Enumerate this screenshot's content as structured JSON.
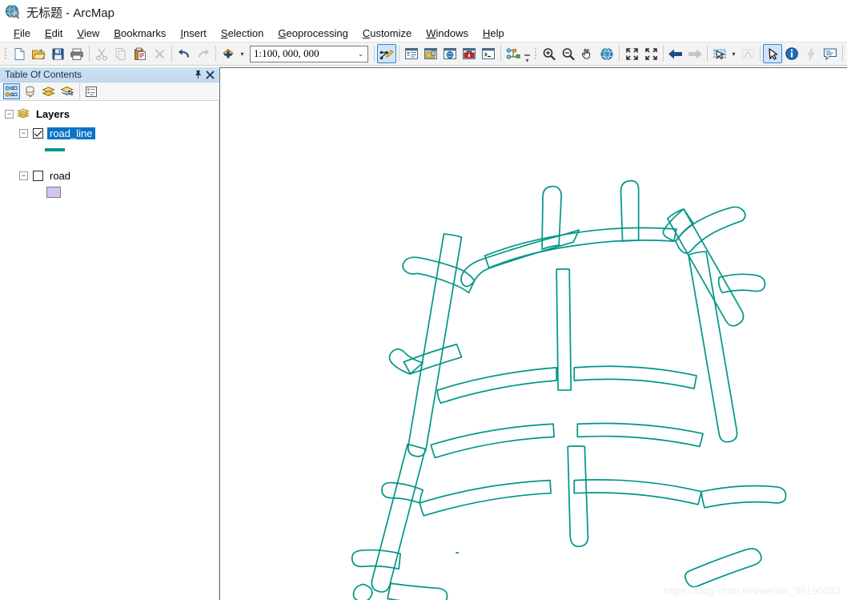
{
  "window": {
    "title": "无标题 - ArcMap",
    "app_icon": "arcmap-globe-icon"
  },
  "menubar": {
    "items": [
      {
        "label": "File",
        "accel": "F"
      },
      {
        "label": "Edit",
        "accel": "E"
      },
      {
        "label": "View",
        "accel": "V"
      },
      {
        "label": "Bookmarks",
        "accel": "B"
      },
      {
        "label": "Insert",
        "accel": "I"
      },
      {
        "label": "Selection",
        "accel": "S"
      },
      {
        "label": "Geoprocessing",
        "accel": "G"
      },
      {
        "label": "Customize",
        "accel": "C"
      },
      {
        "label": "Windows",
        "accel": "W"
      },
      {
        "label": "Help",
        "accel": "H"
      }
    ]
  },
  "standard_toolbar": {
    "buttons": [
      {
        "name": "new-map-document",
        "icon": "new-document-icon",
        "enabled": true
      },
      {
        "name": "open-document",
        "icon": "open-folder-icon",
        "enabled": true
      },
      {
        "name": "save-document",
        "icon": "save-disk-icon",
        "enabled": true
      },
      {
        "name": "print",
        "icon": "printer-icon",
        "enabled": true
      },
      {
        "name": "cut",
        "icon": "scissors-icon",
        "enabled": false
      },
      {
        "name": "copy",
        "icon": "copy-icon",
        "enabled": false
      },
      {
        "name": "paste",
        "icon": "clipboard-paste-icon",
        "enabled": true
      },
      {
        "name": "delete",
        "icon": "close-x-icon",
        "enabled": false
      },
      {
        "name": "undo",
        "icon": "undo-arrow-icon",
        "enabled": true
      },
      {
        "name": "redo",
        "icon": "redo-arrow-icon",
        "enabled": false
      },
      {
        "name": "add-data",
        "icon": "add-data-diamond-icon",
        "enabled": true
      }
    ],
    "scale": {
      "value": "1:100, 000, 000",
      "placeholder": "1:100, 000, 000"
    },
    "window_buttons": [
      {
        "name": "editor-toolbar",
        "icon": "editor-pencil-icon",
        "active": true
      },
      {
        "name": "table-of-contents-window",
        "icon": "toc-window-icon",
        "active": false
      },
      {
        "name": "catalog-window",
        "icon": "catalog-window-icon",
        "active": false
      },
      {
        "name": "search-window",
        "icon": "search-globe-window-icon",
        "active": false
      },
      {
        "name": "arctoolbox-window",
        "icon": "arctoolbox-window-icon",
        "active": false
      },
      {
        "name": "python-window",
        "icon": "python-console-window-icon",
        "active": false
      },
      {
        "name": "model-builder",
        "icon": "model-builder-icon",
        "active": false
      }
    ]
  },
  "tools_toolbar": {
    "buttons": [
      {
        "name": "zoom-in",
        "icon": "magnifier-plus-icon",
        "enabled": true
      },
      {
        "name": "zoom-out",
        "icon": "magnifier-minus-icon",
        "enabled": true
      },
      {
        "name": "pan",
        "icon": "hand-pan-icon",
        "enabled": true
      },
      {
        "name": "full-extent",
        "icon": "globe-icon",
        "enabled": true
      },
      {
        "name": "fixed-zoom-in",
        "icon": "arrows-inward-icon",
        "enabled": true
      },
      {
        "name": "fixed-zoom-out",
        "icon": "arrows-outward-icon",
        "enabled": true
      },
      {
        "name": "go-back-extent",
        "icon": "arrow-left-icon",
        "enabled": true
      },
      {
        "name": "go-forward-extent",
        "icon": "arrow-right-icon",
        "enabled": false
      },
      {
        "name": "select-features",
        "icon": "select-features-icon",
        "enabled": true
      },
      {
        "name": "clear-selected-features",
        "icon": "clear-selection-icon",
        "enabled": false
      },
      {
        "name": "select-elements",
        "icon": "arrow-cursor-icon",
        "enabled": true,
        "active": true
      },
      {
        "name": "identify",
        "icon": "info-circle-icon",
        "enabled": true
      },
      {
        "name": "hyperlink",
        "icon": "lightning-bolt-icon",
        "enabled": false
      },
      {
        "name": "html-popup",
        "icon": "speech-balloon-icon",
        "enabled": true
      },
      {
        "name": "measure",
        "icon": "ruler-measure-icon",
        "enabled": true
      },
      {
        "name": "find",
        "icon": "binoculars-icon",
        "enabled": true
      },
      {
        "name": "go-to-xy",
        "icon": "go-to-xy-icon",
        "enabled": true
      }
    ]
  },
  "table_of_contents": {
    "title": "Table Of Contents",
    "auto_hide_label": "⚲",
    "close_label": "✕",
    "toolbar": [
      {
        "name": "list-by-drawing-order",
        "icon": "list-drawing-order-icon",
        "active": true
      },
      {
        "name": "list-by-source",
        "icon": "list-by-source-icon",
        "active": false
      },
      {
        "name": "list-by-visibility",
        "icon": "list-by-visibility-icon",
        "active": false
      },
      {
        "name": "list-by-selection",
        "icon": "list-by-selection-icon",
        "active": false
      },
      {
        "name": "toc-options",
        "icon": "toc-options-icon",
        "active": false
      }
    ],
    "tree": {
      "root": {
        "label": "Layers",
        "icon": "data-frame-layers-icon",
        "expanded": true
      },
      "layers": [
        {
          "name": "road_line",
          "checked": true,
          "selected": true,
          "expanded": true,
          "symbol_type": "line",
          "symbol_color": "#009688"
        },
        {
          "name": "road",
          "checked": false,
          "selected": false,
          "expanded": true,
          "symbol_type": "polygon",
          "symbol_color": "#d4c2f2",
          "symbol_outline": "#7c7c8c"
        }
      ]
    }
  },
  "map_view": {
    "background": "#ffffff",
    "feature_stroke": "#009688",
    "feature_stroke_width": 1.6,
    "watermark": "https://blog.csdn.net/weixin_39190382",
    "description": "road_line layer: buffered road network rendered as teal outline polygons forming a curved grid of streets"
  }
}
